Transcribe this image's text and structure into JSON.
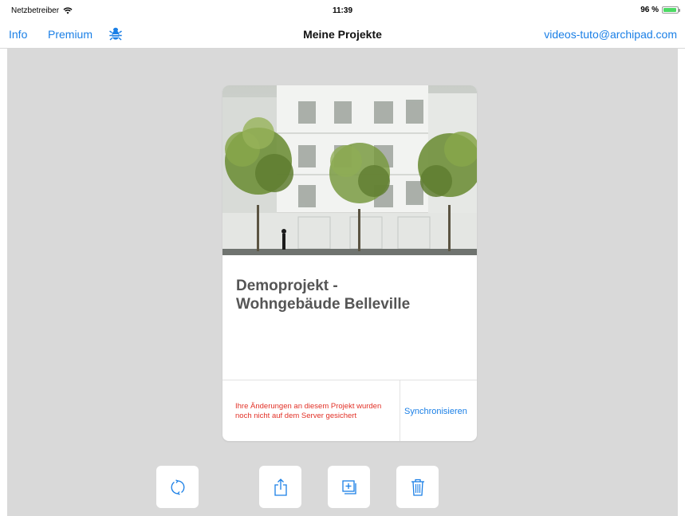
{
  "status": {
    "carrier": "Netzbetreiber",
    "time": "11:39",
    "battery": "96 %",
    "battery_level": 0.96,
    "wifi_icon": "wifi-icon",
    "battery_icon": "battery-icon"
  },
  "nav": {
    "info": "Info",
    "premium": "Premium",
    "title": "Meine Projekte",
    "account": "videos-tuto@archipad.com",
    "bug_icon": "bug-icon",
    "accent_color": "#1a7fe6"
  },
  "project": {
    "title_line1": "Demoprojekt -",
    "title_line2": "Wohngebäude Belleville",
    "warning_line1": "Ihre Änderungen an diesem Projekt wurden",
    "warning_line2": "noch nicht auf dem Server gesichert",
    "sync": "Synchronisieren",
    "warning_color": "#e23127"
  },
  "toolbar": [
    {
      "icon": "refresh-icon"
    },
    {
      "icon": "share-icon"
    },
    {
      "icon": "duplicate-icon"
    },
    {
      "icon": "trash-icon"
    }
  ]
}
